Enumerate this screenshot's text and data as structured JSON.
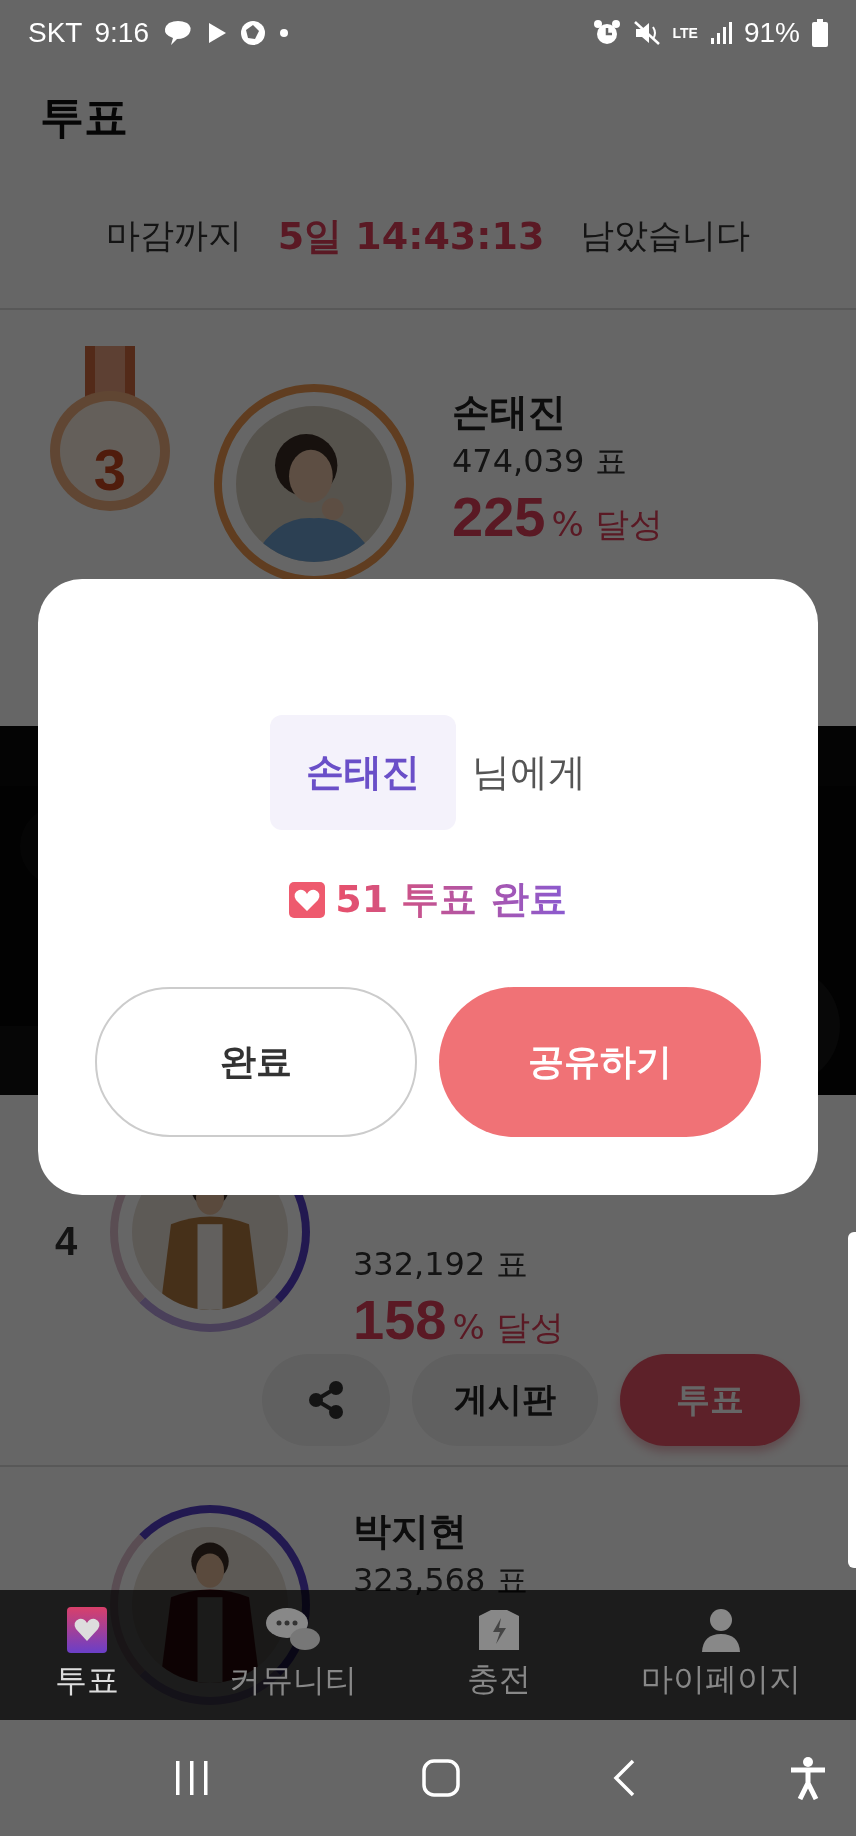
{
  "status_bar": {
    "carrier": "SKT",
    "time": "9:16",
    "network": "LTE",
    "battery": "91%"
  },
  "header": {
    "title": "투표"
  },
  "countdown": {
    "prefix": "마감까지",
    "remaining": "5일 14:43:13",
    "suffix": "남았습니다"
  },
  "candidates": [
    {
      "kind": "medal",
      "rank": "3",
      "name": "손태진",
      "votes": "474,039 표",
      "percent": "225",
      "percent_unit": "% 달성"
    },
    {
      "kind": "picture"
    },
    {
      "kind": "number",
      "rank": "4",
      "votes": "332,192 표",
      "percent": "158",
      "percent_unit": "% 달성",
      "board_button": "게시판",
      "vote_button": "투표"
    },
    {
      "kind": "number",
      "name": "박지현",
      "votes": "323,568 표"
    }
  ],
  "dialog": {
    "recipient": "손태진",
    "recipient_suffix": "님에게",
    "vote_count": "51",
    "vote_label": "투표 완료",
    "buttons": [
      {
        "label": "완료",
        "kind": "secondary"
      },
      {
        "label": "공유하기",
        "kind": "primary"
      }
    ]
  },
  "bottom_nav": [
    {
      "label": "투표",
      "selected": true
    },
    {
      "label": "커뮤니티",
      "selected": false
    },
    {
      "label": "충전",
      "selected": false
    },
    {
      "label": "마이페이지",
      "selected": false
    }
  ]
}
